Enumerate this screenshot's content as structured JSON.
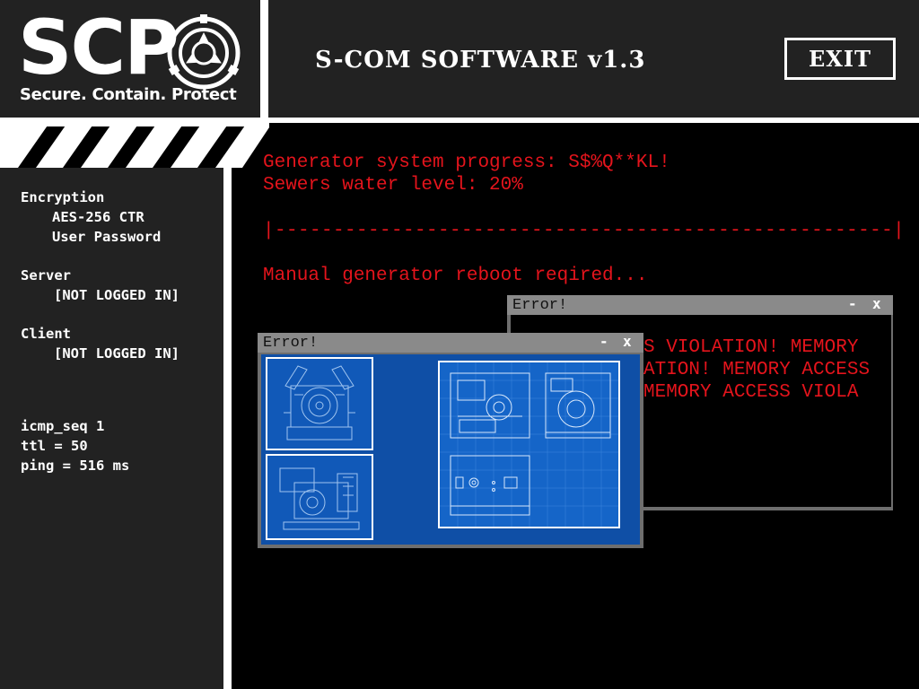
{
  "header": {
    "logo_text": "SCP",
    "logo_tagline": "Secure. Contain. Protect",
    "title": "S-COM SOFTWARE v1.3",
    "exit_label": "EXIT"
  },
  "left_panel": {
    "encryption": {
      "label": "Encryption",
      "values": [
        "AES-256 CTR",
        "User Password"
      ]
    },
    "server": {
      "label": "Server",
      "value": "[NOT LOGGED IN]"
    },
    "client": {
      "label": "Client",
      "value": "[NOT LOGGED IN]"
    },
    "network": {
      "icmp_seq": "icmp_seq 1",
      "ttl": "ttl = 50",
      "ping": "ping = 516 ms"
    }
  },
  "console": {
    "line1": "Generator system progress: S$%Q**KL!",
    "line2": "Sewers water level: 20%",
    "progress_bar": "|-----------------------------------------------------|",
    "line3": "Manual generator reboot reqired..."
  },
  "error_window_back": {
    "title": "Error!",
    "minimize": "-",
    "close": "x",
    "lines": [
      "S VIOLATION! MEMORY",
      "ATION! MEMORY ACCESS",
      "MEMORY ACCESS VIOLA"
    ]
  },
  "error_window_front": {
    "title": "Error!",
    "minimize": "-",
    "close": "x"
  },
  "colors": {
    "accent": "#e4141c",
    "panel": "#222222",
    "blueprint": "#1159b8"
  }
}
